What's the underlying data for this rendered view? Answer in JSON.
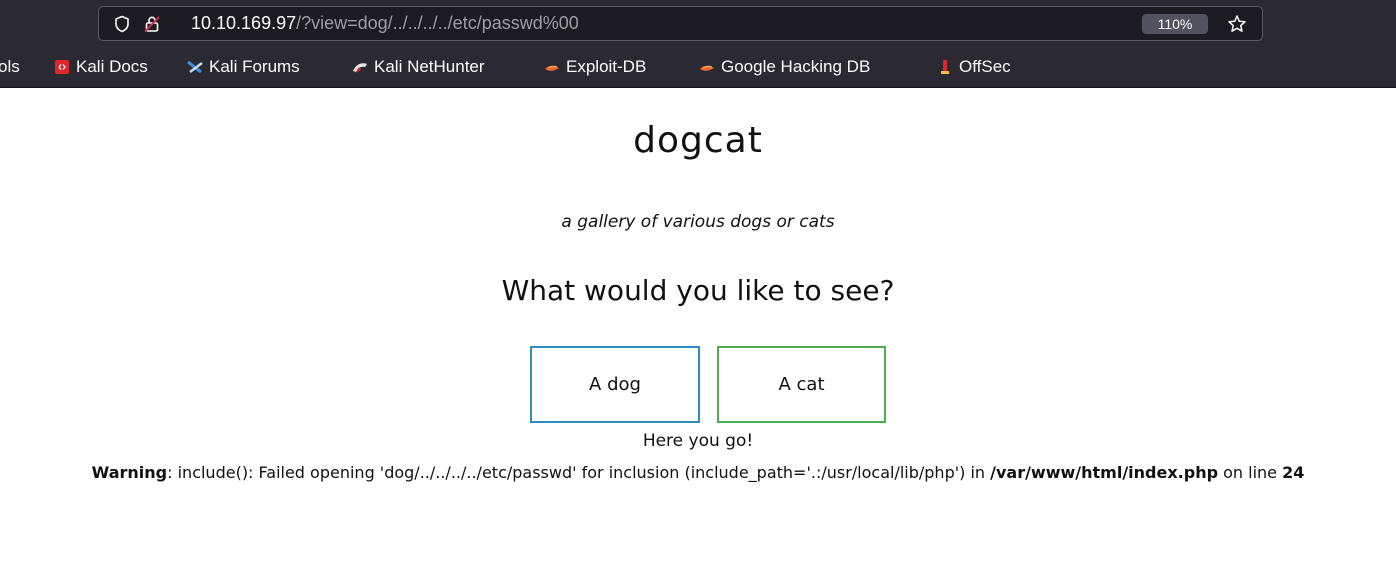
{
  "browser": {
    "url_host": "10.10.169.97",
    "url_path": "/?view=dog/../../../../etc/passwd%00",
    "zoom": "110%",
    "bookmarks": [
      {
        "label": "ols",
        "icon": "bookmark-folder-icon"
      },
      {
        "label": "Kali Docs",
        "icon": "kali-docs-icon"
      },
      {
        "label": "Kali Forums",
        "icon": "kali-forums-icon"
      },
      {
        "label": "Kali NetHunter",
        "icon": "kali-nethunter-icon"
      },
      {
        "label": "Exploit-DB",
        "icon": "exploit-db-icon"
      },
      {
        "label": "Google Hacking DB",
        "icon": "ghdb-icon"
      },
      {
        "label": "OffSec",
        "icon": "offsec-icon"
      }
    ]
  },
  "page": {
    "title": "dogcat",
    "tagline": "a gallery of various dogs or cats",
    "question": "What would you like to see?",
    "buttons": {
      "dog": "A dog",
      "cat": "A cat"
    },
    "result": "Here you go!",
    "warning": {
      "label": "Warning",
      "text_before": ": include(): Failed opening 'dog/../../../../etc/passwd' for inclusion (include_path='.:/usr/local/lib/php') in ",
      "file": "/var/www/html/index.php",
      "text_mid": " on line ",
      "line": "24"
    }
  },
  "colors": {
    "dog_button_border": "#2b8ec2",
    "cat_button_border": "#4cae4f",
    "chrome_bg": "#2b2a33"
  }
}
